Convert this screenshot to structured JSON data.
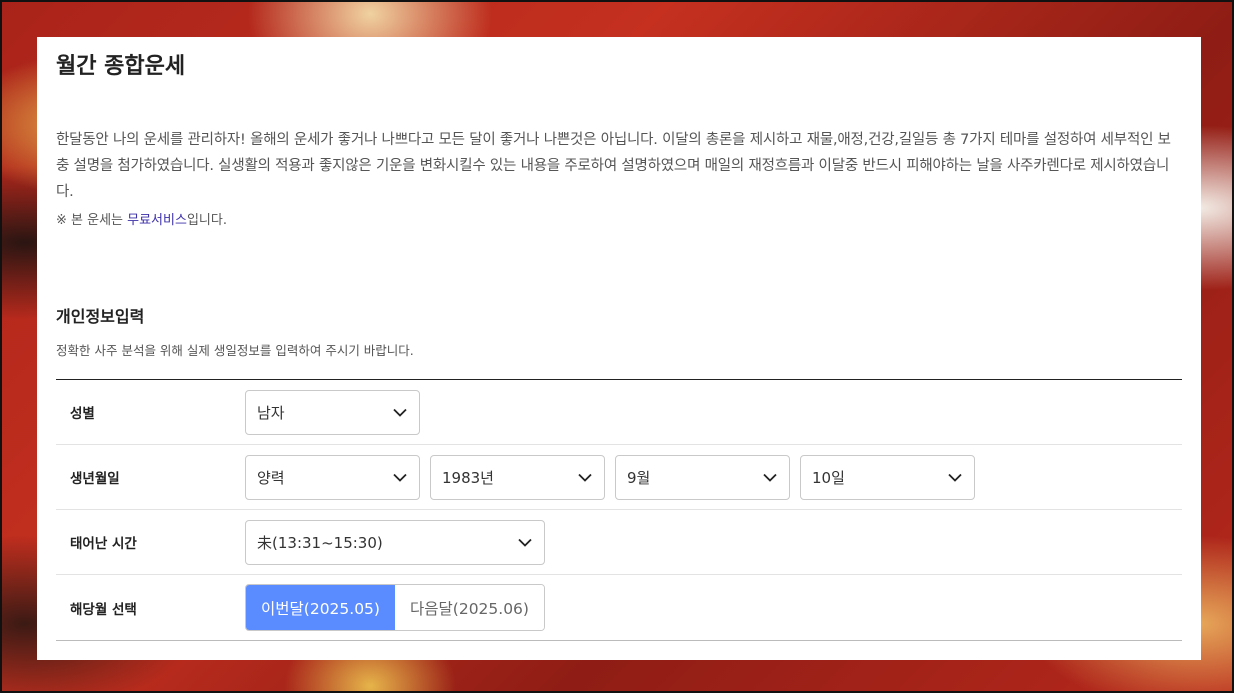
{
  "page": {
    "title": "월간 종합운세",
    "description": "한달동안 나의 운세를 관리하자! 올해의 운세가 좋거나 나쁘다고 모든 달이 좋거나 나쁜것은 아닙니다. 이달의 총론을 제시하고 재물,애정,건강,길일등 총 7가지 테마를 설정하여 세부적인 보충 설명을 첨가하였습니다. 실생활의 적용과 좋지않은 기운을 변화시킬수 있는 내용을 주로하여 설명하였으며 매일의 재정흐름과 이달중 반드시 피해야하는 날을 사주카렌다로 제시하였습니다.",
    "note_prefix": "※ 본 운세는 ",
    "note_link": "무료서비스",
    "note_suffix": "입니다."
  },
  "section": {
    "title": "개인정보입력",
    "subtitle": "정확한 사주 분석을 위해 실제 생일정보를 입력하여 주시기 바랍니다."
  },
  "form": {
    "gender": {
      "label": "성별",
      "value": "남자"
    },
    "birth": {
      "label": "생년월일",
      "calendar": "양력",
      "year": "1983년",
      "month": "9월",
      "day": "10일"
    },
    "time": {
      "label": "태어난 시간",
      "value": "未(13:31~15:30)"
    },
    "month_select": {
      "label": "해당월 선택",
      "options": [
        "이번달(2025.05)",
        "다음달(2025.06)"
      ],
      "selected": "이번달(2025.05)"
    }
  },
  "colors": {
    "accent": "#5b8cff",
    "link": "#3b2fa8"
  },
  "icons": {
    "dropdown": "chevron-down-icon"
  }
}
